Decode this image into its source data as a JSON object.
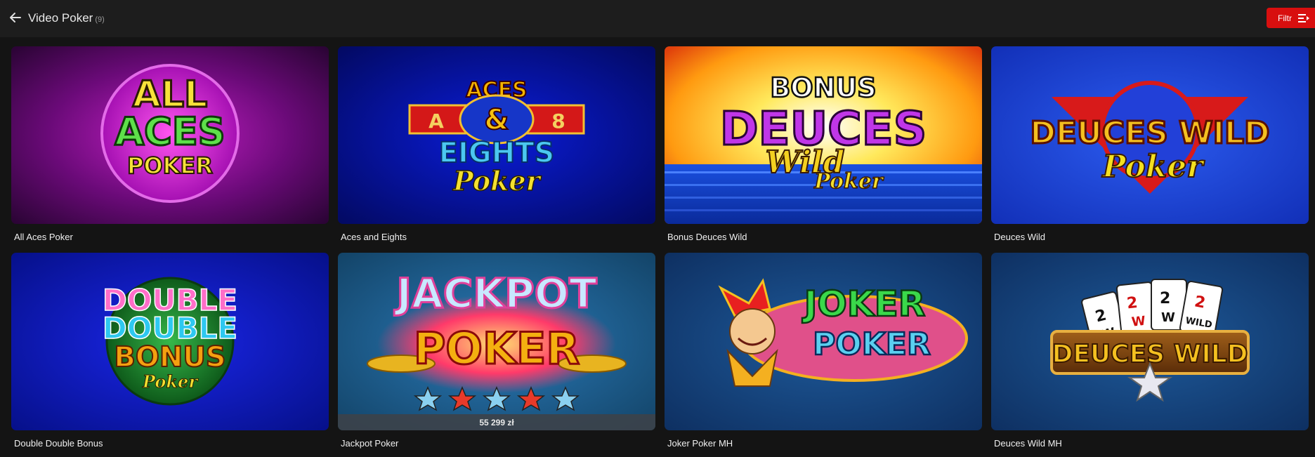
{
  "header": {
    "back_icon": "arrow-left-icon",
    "title": "Video Poker",
    "count": "(9)",
    "filter_label": "Filtr",
    "filter_icon": "filter-lines-icon"
  },
  "games": [
    {
      "name": "All Aces Poker",
      "logo": [
        "ALL",
        "ACES",
        "POKER"
      ]
    },
    {
      "name": "Aces and Eights",
      "logo": [
        "ACES",
        "A",
        "&",
        "8",
        "EIGHTS",
        "Poker"
      ]
    },
    {
      "name": "Bonus Deuces Wild",
      "logo": [
        "BONUS",
        "DEUCES",
        "Wild",
        "Poker"
      ]
    },
    {
      "name": "Deuces Wild",
      "logo": [
        "DEUCES WILD",
        "Poker"
      ]
    },
    {
      "name": "Double Double Bonus",
      "logo": [
        "DOUBLE",
        "DOUBLE",
        "BONUS",
        "Poker"
      ]
    },
    {
      "name": "Jackpot Poker",
      "logo": [
        "JACKPOT",
        "POKER"
      ],
      "jackpot": "55 299 zł"
    },
    {
      "name": "Joker Poker MH",
      "logo": [
        "JOKER",
        "POKER"
      ]
    },
    {
      "name": "Deuces Wild MH",
      "logo": [
        "DEUCES WILD",
        "2",
        "W",
        "2",
        "W",
        "2",
        "W",
        "2",
        "WILD"
      ]
    }
  ],
  "colors": {
    "background": "#141414",
    "header": "#1d1d1d",
    "filter_button": "#d80f0f"
  }
}
